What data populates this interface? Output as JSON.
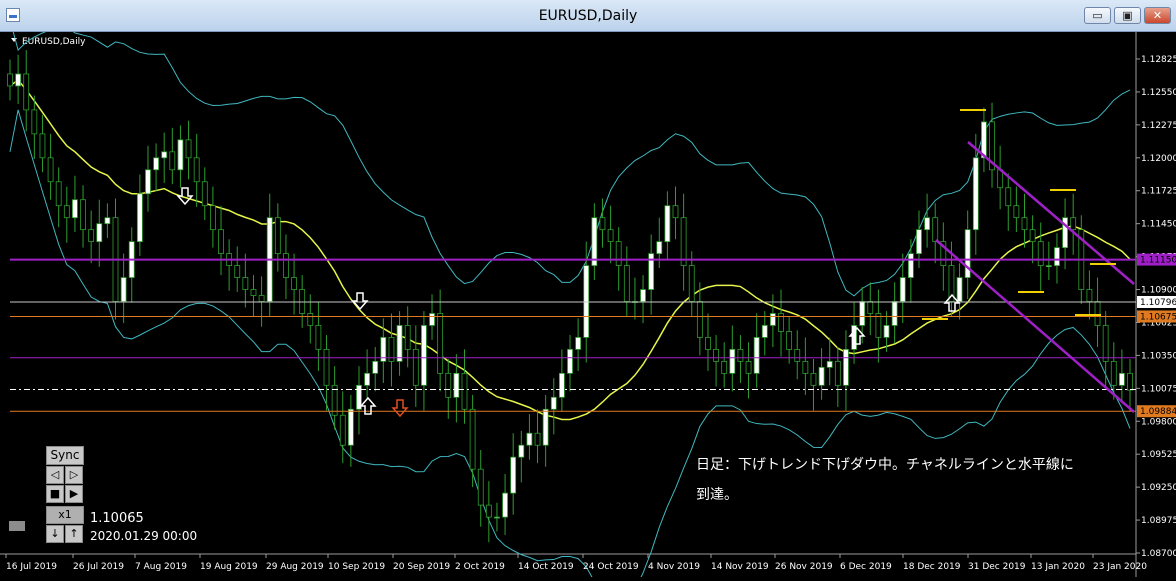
{
  "window": {
    "title": "EURUSD,Daily",
    "minimize": "▭",
    "restore": "▣",
    "close": "✕"
  },
  "symbol_label": "EURUSD,Daily",
  "colors": {
    "bull": "#ffffff",
    "bear": "#000000",
    "wick": "#2e9e2e",
    "ma": "#e6f54a",
    "bands": "#40b8c0",
    "channel": "#a020c8",
    "hline_purple": "#a020c8",
    "hline_orange": "#e07a20",
    "hline_blue": "#5a7ad0",
    "target": "#f0d000"
  },
  "price_axis": {
    "ticks": [
      "1.12825",
      "1.12550",
      "1.12275",
      "1.12000",
      "1.11725",
      "1.11450",
      "1.11175",
      "1.10900",
      "1.10625",
      "1.10350",
      "1.10075",
      "1.09800",
      "1.09525",
      "1.09250",
      "1.08975",
      "1.08700"
    ],
    "highlights": [
      {
        "label": "1.11150",
        "price": 1.1115,
        "color": "#a020c8"
      },
      {
        "label": "1.10796",
        "price": 1.10796,
        "color": "#ffffff"
      },
      {
        "label": "1.10675",
        "price": 1.10675,
        "color": "#e07a20"
      },
      {
        "label": "1.09884",
        "price": 1.09884,
        "color": "#e07a20"
      }
    ]
  },
  "date_axis": [
    "16 Jul 2019",
    "26 Jul 2019",
    "7 Aug 2019",
    "19 Aug 2019",
    "29 Aug 2019",
    "10 Sep 2019",
    "20 Sep 2019",
    "2 Oct 2019",
    "14 Oct 2019",
    "24 Oct 2019",
    "4 Nov 2019",
    "14 Nov 2019",
    "26 Nov 2019",
    "6 Dec 2019",
    "18 Dec 2019",
    "31 Dec 2019",
    "13 Jan 2020",
    "23 Jan 2020"
  ],
  "controls": {
    "sync": "Sync",
    "prev": "◁",
    "next": "▷",
    "stop": "■",
    "play": "▶",
    "speed": "x1",
    "down": "↓",
    "up": "↑"
  },
  "readout": {
    "price": "1.10065",
    "time": "2020.01.29 00:00"
  },
  "note": {
    "line1": "日足：下げトレンド下げダウ中。チャネルラインと水平線に",
    "line2": "到達。"
  },
  "chart_data": {
    "type": "candlestick",
    "symbol": "EURUSD",
    "timeframe": "Daily",
    "ylim": [
      1.087,
      1.131
    ],
    "horizontal_lines": [
      1.1115,
      1.10796,
      1.10675,
      1.1033,
      1.10065,
      1.09884
    ],
    "closes": [
      1.126,
      1.127,
      1.124,
      1.122,
      1.12,
      1.118,
      1.116,
      1.115,
      1.1165,
      1.114,
      1.113,
      1.1145,
      1.115,
      1.108,
      1.11,
      1.113,
      1.117,
      1.119,
      1.12,
      1.1205,
      1.119,
      1.1215,
      1.12,
      1.118,
      1.116,
      1.114,
      1.112,
      1.111,
      1.11,
      1.109,
      1.1085,
      1.108,
      1.115,
      1.112,
      1.11,
      1.109,
      1.107,
      1.106,
      1.104,
      1.101,
      1.0985,
      1.096,
      1.099,
      1.101,
      1.102,
      1.103,
      1.105,
      1.103,
      1.106,
      1.104,
      1.101,
      1.106,
      1.107,
      1.102,
      1.1,
      1.102,
      1.099,
      1.094,
      1.091,
      1.09,
      1.09,
      1.092,
      1.095,
      1.096,
      1.097,
      1.096,
      1.099,
      1.1,
      1.102,
      1.104,
      1.105,
      1.111,
      1.115,
      1.114,
      1.113,
      1.111,
      1.108,
      1.108,
      1.109,
      1.112,
      1.113,
      1.116,
      1.115,
      1.111,
      1.108,
      1.105,
      1.104,
      1.103,
      1.102,
      1.104,
      1.103,
      1.102,
      1.105,
      1.106,
      1.107,
      1.1055,
      1.104,
      1.103,
      1.102,
      1.101,
      1.1025,
      1.103,
      1.101,
      1.104,
      1.106,
      1.108,
      1.107,
      1.105,
      1.106,
      1.108,
      1.11,
      1.112,
      1.114,
      1.115,
      1.113,
      1.111,
      1.108,
      1.11,
      1.114,
      1.12,
      1.123,
      1.119,
      1.1175,
      1.116,
      1.115,
      1.114,
      1.113,
      1.111,
      1.111,
      1.1125,
      1.115,
      1.114,
      1.109,
      1.108,
      1.106,
      1.103,
      1.101,
      1.102,
      1.1006
    ]
  }
}
